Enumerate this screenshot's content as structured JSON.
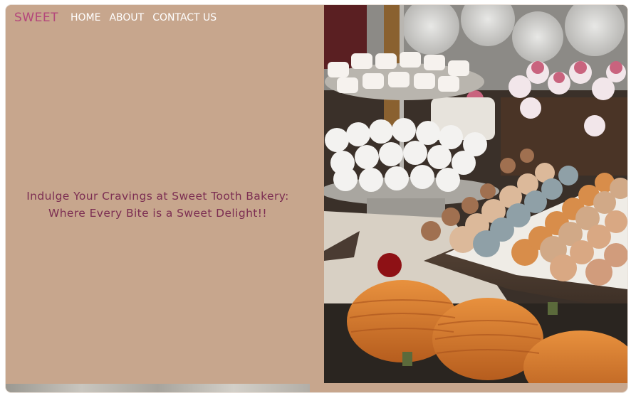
{
  "nav": {
    "brand": "SWEET",
    "links": [
      "HOME",
      "ABOUT",
      "CONTACT US"
    ]
  },
  "hero": {
    "tagline_line1": "Indulge Your Cravings at Sweet Tooth Bakery:",
    "tagline_line2": "Where Every Bite is a Sweet Delight!!"
  },
  "colors": {
    "panel_background": "#c7a68d",
    "brand": "#b4477b",
    "nav_text": "#ffffff",
    "tagline_text": "#7c2e52"
  }
}
